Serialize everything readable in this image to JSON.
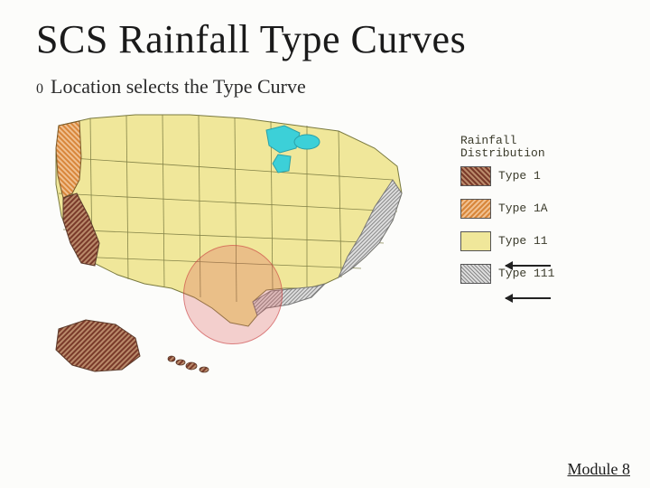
{
  "title": "SCS Rainfall Type Curves",
  "bullet": {
    "marker": "0",
    "text": "Location selects the Type Curve"
  },
  "legend": {
    "heading_line1": "Rainfall",
    "heading_line2": "Distribution",
    "items": [
      {
        "label": "Type 1",
        "swatch": "swatch-1"
      },
      {
        "label": "Type 1A",
        "swatch": "swatch-1a"
      },
      {
        "label": "Type 11",
        "swatch": "swatch-2"
      },
      {
        "label": "Type 111",
        "swatch": "swatch-3"
      }
    ]
  },
  "map": {
    "lake_color": "#3cd0d8",
    "land_color": "#f0e79a",
    "type1_color": "#7a3a2a",
    "type1a_color": "#d8863a",
    "type3_color": "#a0a0a0",
    "outline": "#7a7a40"
  },
  "footer": "Module 8"
}
